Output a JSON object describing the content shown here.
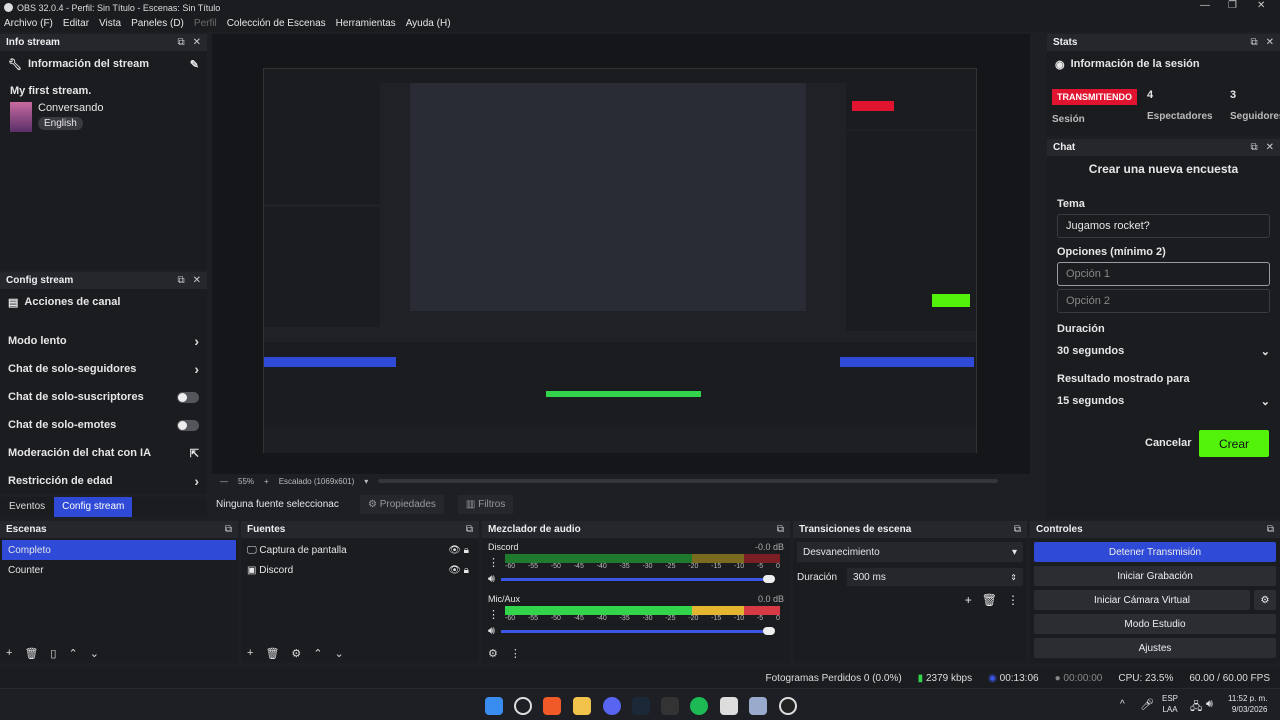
{
  "window": {
    "title": "OBS 32.0.4 - Perfil: Sin Título - Escenas: Sin Título"
  },
  "menu": [
    "Archivo (F)",
    "Editar",
    "Vista",
    "Paneles (D)",
    "Perfil",
    "Colección de Escenas",
    "Herramientas",
    "Ayuda (H)"
  ],
  "info_stream": {
    "dock_title": "Info stream",
    "header": "Información del stream",
    "stream_title": "My first stream.",
    "category": "Conversando",
    "language": "English"
  },
  "config_stream": {
    "dock_title": "Config stream",
    "header": "Acciones de canal",
    "items": [
      {
        "label": "Modo lento",
        "control": "chevron"
      },
      {
        "label": "Chat de solo-seguidores",
        "control": "chevron"
      },
      {
        "label": "Chat de solo-suscriptores",
        "control": "toggle"
      },
      {
        "label": "Chat de solo-emotes",
        "control": "toggle"
      },
      {
        "label": "Moderación del chat con IA",
        "control": "external"
      },
      {
        "label": "Restricción de edad",
        "control": "chevron"
      }
    ]
  },
  "left_tabs": [
    "Eventos",
    "Config stream"
  ],
  "stats": {
    "dock_title": "Stats",
    "header": "Información de la sesión",
    "badge": "TRANSMITIENDO",
    "viewers": "4",
    "followers": "3",
    "session_label": "Sesión",
    "viewers_label": "Espectadores",
    "followers_label": "Seguidores"
  },
  "chat": {
    "dock_title": "Chat",
    "heading": "Crear una nueva encuesta",
    "tema_label": "Tema",
    "tema_value": "Jugamos rocket?",
    "opciones_label": "Opciones (mínimo 2)",
    "option1_placeholder": "Opción 1",
    "option2_placeholder": "Opción 2",
    "duracion_label": "Duración",
    "duracion_value": "30 segundos",
    "resultado_label": "Resultado mostrado para",
    "resultado_value": "15 segundos",
    "cancel": "Cancelar",
    "create": "Crear"
  },
  "preview_bar": {
    "zoom": "55%",
    "scale": "Escalado (1069x601)"
  },
  "source_bar": {
    "no_source": "Ninguna fuente seleccionac",
    "props": "Propiedades",
    "filters": "Filtros"
  },
  "escenas": {
    "title": "Escenas",
    "items": [
      "Completo",
      "Counter"
    ]
  },
  "fuentes": {
    "title": "Fuentes",
    "items": [
      "Captura de pantalla",
      "Discord"
    ]
  },
  "mixer": {
    "title": "Mezclador de audio",
    "channels": [
      {
        "name": "Discord",
        "db": "-0.0 dB",
        "level": 0
      },
      {
        "name": "Mic/Aux",
        "db": "0.0 dB",
        "level": 1
      }
    ],
    "ticks": [
      "-60",
      "-55",
      "-50",
      "-45",
      "-40",
      "-35",
      "-30",
      "-25",
      "-20",
      "-15",
      "-10",
      "-5",
      "0"
    ]
  },
  "transiciones": {
    "title": "Transiciones de escena",
    "selected": "Desvanecimiento",
    "duration_label": "Duración",
    "duration_value": "300 ms"
  },
  "controles": {
    "title": "Controles",
    "buttons": [
      "Detener Transmisión",
      "Iniciar Grabación",
      "Iniciar Cámara Virtual",
      "Modo Estudio",
      "Ajustes"
    ]
  },
  "status": {
    "dropped": "Fotogramas Perdidos 0 (0.0%)",
    "bitrate": "2379 kbps",
    "stream_time": "00:13:06",
    "rec_time": "00:00:00",
    "cpu": "CPU: 23.5%",
    "fps": "60.00 / 60.00 FPS"
  },
  "taskbar": {
    "lang": "ESP",
    "layout": "LAA",
    "time": "11:52 p. m.",
    "date": "9/03/2026"
  },
  "colors": {
    "accent": "#2e4ad6",
    "live": "#e0142f",
    "create": "#52f20a"
  }
}
